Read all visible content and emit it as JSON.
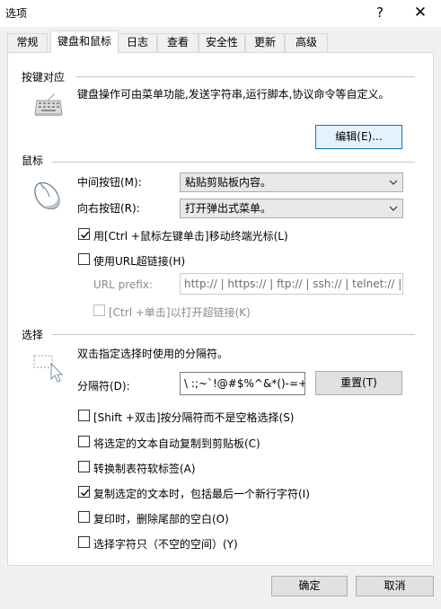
{
  "window": {
    "title": "选项",
    "help_glyph": "?",
    "close_glyph": "✕"
  },
  "tabs": [
    {
      "label": "常规",
      "active": false
    },
    {
      "label": "键盘和鼠标",
      "active": true
    },
    {
      "label": "日志",
      "active": false
    },
    {
      "label": "查看",
      "active": false
    },
    {
      "label": "安全性",
      "active": false
    },
    {
      "label": "更新",
      "active": false
    },
    {
      "label": "高级",
      "active": false
    }
  ],
  "keymap": {
    "title": "按键对应",
    "description": "键盘操作可由菜单功能,发送字符串,运行脚本,协议命令等自定义。",
    "edit_button": "编辑(E)..."
  },
  "mouse": {
    "title": "鼠标",
    "middle_label": "中间按钮(M):",
    "middle_value": "粘贴剪贴板内容。",
    "right_label": "向右按钮(R):",
    "right_value": "打开弹出式菜单。",
    "ctrl_click_move_label": "用[Ctrl +鼠标左键单击]移动终端光标(L)",
    "ctrl_click_move_checked": true,
    "use_url_label": "使用URL超链接(H)",
    "use_url_checked": false,
    "url_prefix_label": "URL prefix:",
    "url_prefix_value": "http:// | https:// | ftp:// | ssh:// | telnet:// |",
    "ctrl_click_open_label": "[Ctrl +单击]以打开超链接(K)",
    "ctrl_click_open_checked": false
  },
  "selection": {
    "title": "选择",
    "description": "双击指定选择时使用的分隔符。",
    "delimiter_label": "分隔符(D):",
    "delimiter_value": "\\ :;~`!@#$%^&*()-=+|[",
    "reset_button": "重置(T)",
    "options": [
      {
        "label": "[Shift +双击]按分隔符而不是空格选择(S)",
        "checked": false
      },
      {
        "label": "将选定的文本自动复制到剪贴板(C)",
        "checked": false
      },
      {
        "label": "转换制表符软标签(A)",
        "checked": false
      },
      {
        "label": "复制选定的文本时，包括最后一个新行字符(I)",
        "checked": true
      },
      {
        "label": "复印时，删除尾部的空白(O)",
        "checked": false
      },
      {
        "label": "选择字符只（不空的空间）(Y)",
        "checked": false
      }
    ]
  },
  "footer": {
    "ok": "确定",
    "cancel": "取消"
  },
  "colors": {
    "accent": "#0078d7",
    "panel_bg": "#ffffff",
    "window_bg": "#f0f0f0"
  }
}
